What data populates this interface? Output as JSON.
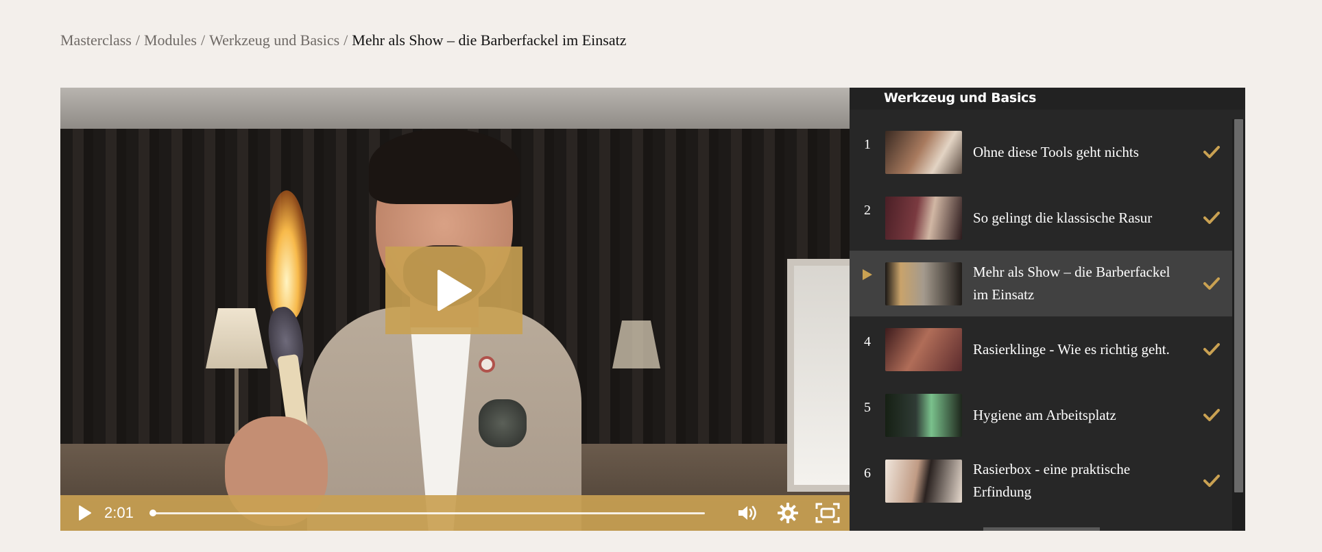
{
  "breadcrumb": {
    "items": [
      "Masterclass",
      "Modules",
      "Werkzeug und Basics"
    ],
    "separator": "/",
    "current": "Mehr als Show – die Barberfackel im Einsatz"
  },
  "player": {
    "time": "2:01",
    "progress": 0.0,
    "icons": {
      "big_play": "play-icon",
      "play": "play-icon",
      "volume": "volume-icon",
      "settings": "gear-icon",
      "fullscreen": "fullscreen-icon"
    },
    "accent_color": "#c9a152"
  },
  "sidebar": {
    "module_title": "Werkzeug und Basics",
    "lessons": [
      {
        "num": "1",
        "title": "Ohne diese Tools geht nichts",
        "completed": true
      },
      {
        "num": "2",
        "title": "So gelingt die klassische Rasur",
        "completed": true
      },
      {
        "num": "",
        "title": "Mehr als Show – die Barberfackel im Einsatz",
        "completed": true,
        "active": true
      },
      {
        "num": "4",
        "title": "Rasierklinge - Wie es richtig geht.",
        "completed": true
      },
      {
        "num": "5",
        "title": "Hygiene am Arbeitsplatz",
        "completed": true
      },
      {
        "num": "6",
        "title": "Rasierbox - eine praktische Erfindung",
        "completed": true
      }
    ],
    "check_color": "#c9a152",
    "active_icon": "play-triangle-icon"
  }
}
